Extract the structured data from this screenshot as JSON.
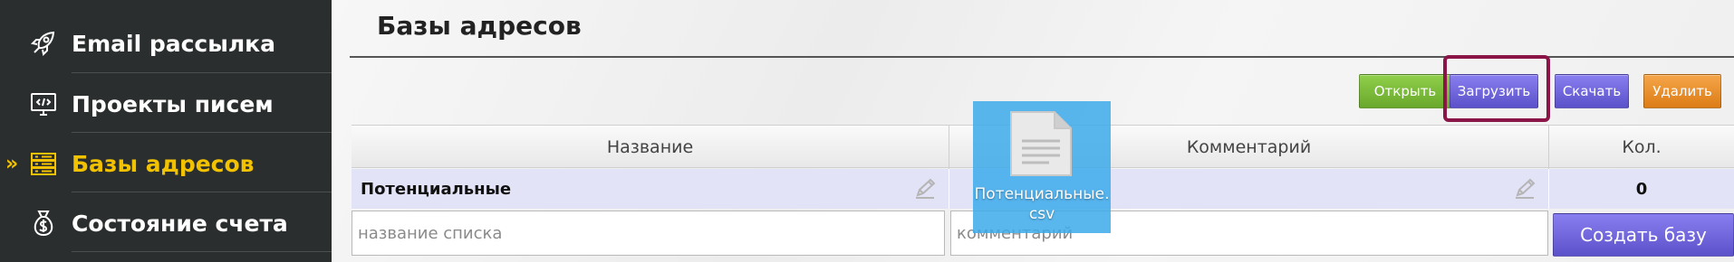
{
  "sidebar": {
    "items": [
      {
        "label": "Email рассылка",
        "icon": "rocket-icon",
        "active": false
      },
      {
        "label": "Проекты писем",
        "icon": "monitor-code-icon",
        "active": false
      },
      {
        "label": "Базы адресов",
        "icon": "server-list-icon",
        "active": true
      },
      {
        "label": "Состояние счета",
        "icon": "money-bag-icon",
        "active": false
      }
    ],
    "active_marker": "»"
  },
  "main": {
    "title": "Базы адресов",
    "toolbar": {
      "open_label": "Открыть",
      "upload_label": "Загрузить",
      "download_label": "Скачать",
      "delete_label": "Удалить"
    },
    "table": {
      "columns": [
        "Название",
        "Комментарий",
        "Кол."
      ],
      "rows": [
        {
          "name": "Потенциальные",
          "comment": "",
          "count": "0"
        }
      ]
    },
    "new_base": {
      "name_placeholder": "название списка",
      "comment_placeholder": "комментарий",
      "create_label": "Создать базу"
    },
    "drag_file": {
      "icon": "document-file-icon",
      "label": "Потенциальные.csv"
    }
  },
  "colors": {
    "sidebar_bg": "#2a2e2e",
    "active_accent": "#f2c200",
    "green_button": "#7ab83a",
    "purple_button": "#6a60d8",
    "orange_button": "#e88e24",
    "highlight": "#8b1547",
    "row_bg": "#e3e3f7"
  }
}
